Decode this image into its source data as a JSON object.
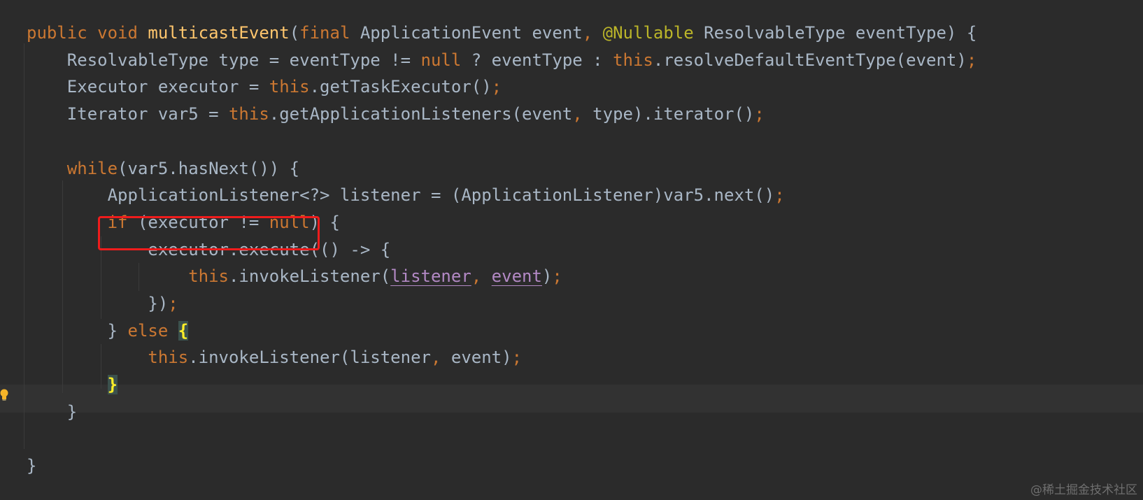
{
  "editor": {
    "lines": [
      {
        "indent": "",
        "tokens": [
          {
            "text": "public void ",
            "type": "kw"
          },
          {
            "text": "multicastEvent",
            "type": "fn"
          },
          {
            "text": "(",
            "type": "pl"
          },
          {
            "text": "final ",
            "type": "kw"
          },
          {
            "text": "ApplicationEvent event",
            "type": "pl"
          },
          {
            "text": ", ",
            "type": "kw"
          },
          {
            "text": "@Nullable ",
            "type": "ann"
          },
          {
            "text": "ResolvableType eventType) {",
            "type": "pl"
          }
        ]
      },
      {
        "indent": "    ",
        "tokens": [
          {
            "text": "ResolvableType type = eventType != ",
            "type": "pl"
          },
          {
            "text": "null ",
            "type": "kw"
          },
          {
            "text": "? eventType : ",
            "type": "pl"
          },
          {
            "text": "this",
            "type": "kw"
          },
          {
            "text": ".resolveDefaultEventType(event)",
            "type": "pl"
          },
          {
            "text": ";",
            "type": "kw"
          }
        ]
      },
      {
        "indent": "    ",
        "tokens": [
          {
            "text": "Executor executor = ",
            "type": "pl"
          },
          {
            "text": "this",
            "type": "kw"
          },
          {
            "text": ".getTaskExecutor()",
            "type": "pl"
          },
          {
            "text": ";",
            "type": "kw"
          }
        ]
      },
      {
        "indent": "    ",
        "tokens": [
          {
            "text": "Iterator var5 = ",
            "type": "pl"
          },
          {
            "text": "this",
            "type": "kw"
          },
          {
            "text": ".getApplicationListeners(event",
            "type": "pl"
          },
          {
            "text": ", ",
            "type": "kw"
          },
          {
            "text": "type).iterator()",
            "type": "pl"
          },
          {
            "text": ";",
            "type": "kw"
          }
        ]
      },
      {
        "indent": "",
        "tokens": []
      },
      {
        "indent": "    ",
        "tokens": [
          {
            "text": "while",
            "type": "kw"
          },
          {
            "text": "(var5.hasNext()) {",
            "type": "pl"
          }
        ]
      },
      {
        "indent": "        ",
        "tokens": [
          {
            "text": "ApplicationListener<?> listener = (ApplicationListener)var5.next()",
            "type": "pl"
          },
          {
            "text": ";",
            "type": "kw"
          }
        ]
      },
      {
        "indent": "        ",
        "tokens": [
          {
            "text": "if ",
            "type": "kw"
          },
          {
            "text": "(executor != ",
            "type": "pl"
          },
          {
            "text": "null",
            "type": "kw"
          },
          {
            "text": ") {",
            "type": "pl"
          }
        ]
      },
      {
        "indent": "            ",
        "tokens": [
          {
            "text": "executor.execute(() -> {",
            "type": "pl"
          }
        ]
      },
      {
        "indent": "                ",
        "tokens": [
          {
            "text": "this",
            "type": "kw"
          },
          {
            "text": ".invokeListener(",
            "type": "pl"
          },
          {
            "text": "listener",
            "type": "cap"
          },
          {
            "text": ", ",
            "type": "kw"
          },
          {
            "text": "event",
            "type": "cap"
          },
          {
            "text": ")",
            "type": "pl"
          },
          {
            "text": ";",
            "type": "kw"
          }
        ]
      },
      {
        "indent": "            ",
        "tokens": [
          {
            "text": "})",
            "type": "pl"
          },
          {
            "text": ";",
            "type": "kw"
          }
        ]
      },
      {
        "indent": "        ",
        "tokens": [
          {
            "text": "} ",
            "type": "pl"
          },
          {
            "text": "else ",
            "type": "kw"
          },
          {
            "text": "{",
            "type": "brace-hl"
          }
        ]
      },
      {
        "indent": "            ",
        "tokens": [
          {
            "text": "this",
            "type": "kw"
          },
          {
            "text": ".invokeListener(listener",
            "type": "pl"
          },
          {
            "text": ", ",
            "type": "kw"
          },
          {
            "text": "event)",
            "type": "pl"
          },
          {
            "text": ";",
            "type": "kw"
          }
        ]
      },
      {
        "indent": "        ",
        "tokens": [
          {
            "text": "}",
            "type": "brace-hl"
          }
        ]
      },
      {
        "indent": "    ",
        "tokens": [
          {
            "text": "}",
            "type": "pl"
          }
        ]
      },
      {
        "indent": "",
        "tokens": []
      },
      {
        "indent": "",
        "tokens": [
          {
            "text": "}",
            "type": "pl"
          }
        ]
      }
    ]
  },
  "current_line_number": 14,
  "highlighted_region": "if (executor != null)",
  "gutter_icon": "lightbulb-icon",
  "watermark": "@稀土掘金技术社区",
  "colors": {
    "background": "#2b2b2b",
    "keyword": "#cc7832",
    "function": "#ffc66d",
    "annotation": "#bbb529",
    "plain": "#a9b7c6",
    "captured_var": "#b389c5",
    "highlight_box": "#ef1c1c"
  }
}
